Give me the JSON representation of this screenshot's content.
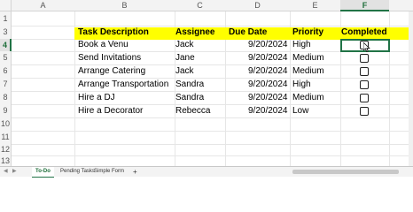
{
  "columns": [
    "A",
    "B",
    "C",
    "D",
    "E",
    "F"
  ],
  "selected_column": "F",
  "rows": [
    "1",
    "2",
    "3",
    "4",
    "5",
    "6",
    "7",
    "8",
    "9",
    "10",
    "11",
    "12",
    "13"
  ],
  "selected_row": "4",
  "table": {
    "headers": {
      "task": "Task Description",
      "assignee": "Assignee",
      "due": "Due Date",
      "priority": "Priority",
      "completed": "Completed"
    },
    "rows": [
      {
        "task": "Book a Venu",
        "assignee": "Jack",
        "due": "9/20/2024",
        "priority": "High"
      },
      {
        "task": "Send Invitations",
        "assignee": "Jane",
        "due": "9/20/2024",
        "priority": "Medium"
      },
      {
        "task": "Arrange Catering",
        "assignee": "Jack",
        "due": "9/20/2024",
        "priority": "Medium"
      },
      {
        "task": "Arrange Transportation",
        "assignee": "Sandra",
        "due": "9/20/2024",
        "priority": "High"
      },
      {
        "task": "Hire a DJ",
        "assignee": "Sandra",
        "due": "9/20/2024",
        "priority": "Medium"
      },
      {
        "task": "Hire a Decorator",
        "assignee": "Rebecca",
        "due": "9/20/2024",
        "priority": "Low"
      }
    ]
  },
  "sheet_tabs": [
    "To-Do",
    "Pending Tasks",
    "Simple Form"
  ],
  "active_tab": "To-Do",
  "add_sheet": "+",
  "colors": {
    "header_highlight": "#ffff00",
    "excel_green": "#217346"
  },
  "icons": {
    "checkbox": "checkbox-icon",
    "cursor": "mouse-pointer-icon"
  }
}
